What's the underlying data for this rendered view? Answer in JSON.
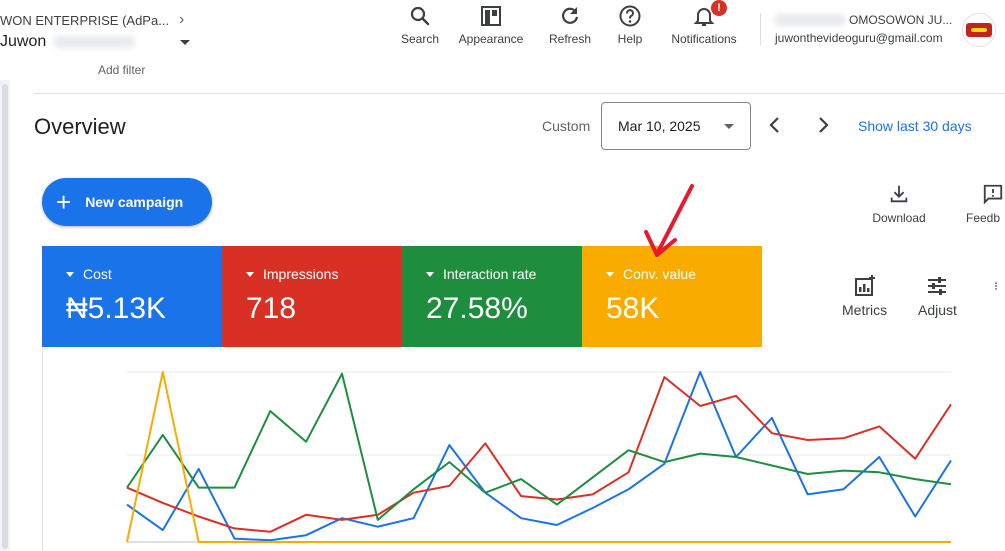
{
  "account": {
    "name": "WON ENTERPRISE (AdPa...",
    "user_short": "Juwon"
  },
  "toolbar": {
    "search": "Search",
    "appearance": "Appearance",
    "refresh": "Refresh",
    "help": "Help",
    "notifications": "Notifications",
    "notification_badge": "!"
  },
  "user": {
    "name": "OMOSOWON JU...",
    "email": "juwonthevideoguru@gmail.com"
  },
  "filter": {
    "add_filter": "Add filter"
  },
  "page": {
    "title": "Overview",
    "date_mode": "Custom",
    "date_value": "Mar 10, 2025",
    "show_last": "Show last 30 days"
  },
  "actions": {
    "new_campaign": "New campaign",
    "download": "Download",
    "feedback": "Feedb",
    "metrics": "Metrics",
    "adjust": "Adjust"
  },
  "scorecards": [
    {
      "label": "Cost",
      "value": "₦5.13K",
      "color": "#1a73e8"
    },
    {
      "label": "Impressions",
      "value": "718",
      "color": "#d93025"
    },
    {
      "label": "Interaction rate",
      "value": "27.58%",
      "color": "#1e8e3e"
    },
    {
      "label": "Conv. value",
      "value": "58K",
      "color": "#f9ab00"
    }
  ],
  "chart_data": {
    "type": "line",
    "x": [
      1,
      2,
      3,
      4,
      5,
      6,
      7,
      8,
      9,
      10,
      11,
      12,
      13,
      14,
      15,
      16,
      17,
      18,
      19,
      20,
      21,
      22,
      23,
      24
    ],
    "series": [
      {
        "color": "#1a73e8",
        "values": [
          0.22,
          0.07,
          0.43,
          0.02,
          0.01,
          0.04,
          0.14,
          0.09,
          0.14,
          0.57,
          0.29,
          0.14,
          0.1,
          0.2,
          0.31,
          0.46,
          1.0,
          0.5,
          0.73,
          0.28,
          0.31,
          0.5,
          0.15,
          0.48
        ]
      },
      {
        "color": "#d93025",
        "values": [
          0.32,
          0.23,
          0.15,
          0.08,
          0.06,
          0.16,
          0.13,
          0.16,
          0.29,
          0.33,
          0.58,
          0.27,
          0.25,
          0.28,
          0.41,
          0.97,
          0.8,
          0.86,
          0.64,
          0.6,
          0.61,
          0.68,
          0.49,
          0.81
        ]
      },
      {
        "color": "#1e8e3e",
        "values": [
          0.32,
          0.63,
          0.32,
          0.32,
          0.77,
          0.59,
          0.99,
          0.13,
          0.31,
          0.47,
          0.29,
          0.37,
          0.22,
          0.38,
          0.54,
          0.47,
          0.52,
          0.5,
          0.45,
          0.4,
          0.42,
          0.41,
          0.37,
          0.34
        ]
      },
      {
        "color": "#f9ab00",
        "values": [
          0.0,
          1.0,
          0.0,
          0.0,
          0.0,
          0.0,
          0.0,
          0.0,
          0.0,
          0.0,
          0.0,
          0.0,
          0.0,
          0.0,
          0.0,
          0.0,
          0.0,
          0.0,
          0.0,
          0.0,
          0.0,
          0.0,
          0.0,
          0.0
        ]
      }
    ],
    "grid": true
  },
  "annotation": {
    "color": "#e8192c"
  }
}
